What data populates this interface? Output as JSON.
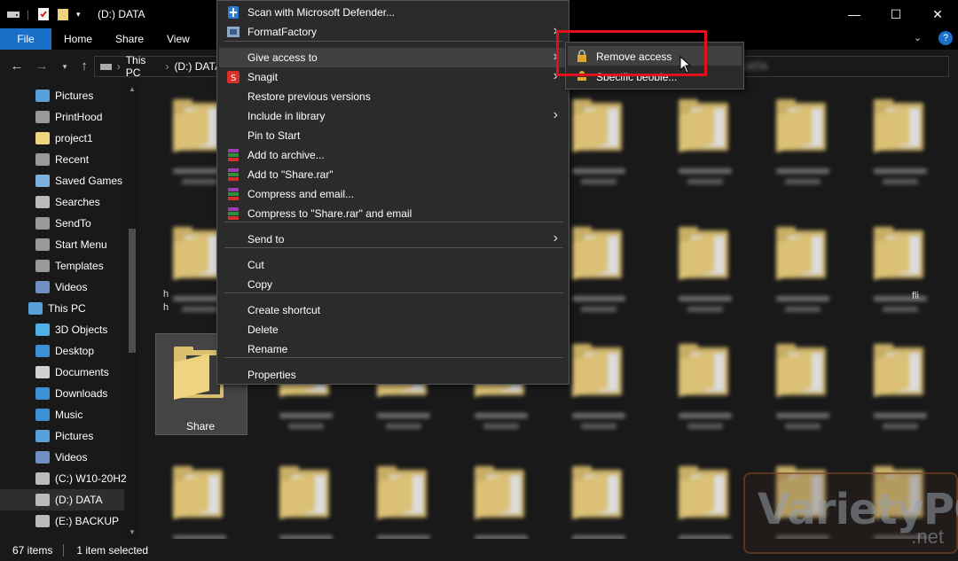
{
  "window": {
    "title": "(D:) DATA",
    "minimize": "—",
    "maximize": "☐",
    "close": "✕",
    "help": "?"
  },
  "ribbon": {
    "tabs": [
      "File",
      "Home",
      "Share",
      "View"
    ]
  },
  "address": {
    "segments": [
      "This PC",
      "(D:) DATA"
    ],
    "search_partial": "DATA"
  },
  "nav": {
    "items": [
      {
        "label": "Pictures",
        "icon": "pictures-icon"
      },
      {
        "label": "PrintHood",
        "icon": "shortcut-folder-icon"
      },
      {
        "label": "project1",
        "icon": "folder-icon"
      },
      {
        "label": "Recent",
        "icon": "recent-icon"
      },
      {
        "label": "Saved Games",
        "icon": "saved-games-icon"
      },
      {
        "label": "Searches",
        "icon": "search-icon"
      },
      {
        "label": "SendTo",
        "icon": "shortcut-folder-icon"
      },
      {
        "label": "Start Menu",
        "icon": "shortcut-folder-icon"
      },
      {
        "label": "Templates",
        "icon": "shortcut-folder-icon"
      },
      {
        "label": "Videos",
        "icon": "videos-icon"
      },
      {
        "label": "This PC",
        "icon": "pc-icon"
      },
      {
        "label": "3D Objects",
        "icon": "3d-objects-icon"
      },
      {
        "label": "Desktop",
        "icon": "desktop-icon"
      },
      {
        "label": "Documents",
        "icon": "documents-icon"
      },
      {
        "label": "Downloads",
        "icon": "downloads-icon"
      },
      {
        "label": "Music",
        "icon": "music-icon"
      },
      {
        "label": "Pictures",
        "icon": "pictures-icon"
      },
      {
        "label": "Videos",
        "icon": "videos-icon"
      },
      {
        "label": "(C:) W10-20H2",
        "icon": "drive-icon"
      },
      {
        "label": "(D:) DATA",
        "icon": "drive-icon"
      },
      {
        "label": "(E:) BACKUP",
        "icon": "drive-icon"
      }
    ]
  },
  "content": {
    "selected_label": "Share",
    "visible_labels": [
      "fli",
      "on Article",
      "h",
      "h"
    ]
  },
  "context_menu": {
    "items": [
      {
        "label": "Scan with Microsoft Defender...",
        "icon": "defender-icon"
      },
      {
        "label": "FormatFactory",
        "icon": "formatfactory-icon",
        "submenu": true
      },
      {
        "label": "Give access to",
        "submenu": true,
        "highlighted": true
      },
      {
        "label": "Snagit",
        "icon": "snagit-icon",
        "submenu": true
      },
      {
        "label": "Restore previous versions"
      },
      {
        "label": "Include in library",
        "submenu": true
      },
      {
        "label": "Pin to Start"
      },
      {
        "label": "Add to archive...",
        "icon": "winrar-icon"
      },
      {
        "label": "Add to \"Share.rar\"",
        "icon": "winrar-icon"
      },
      {
        "label": "Compress and email...",
        "icon": "winrar-icon"
      },
      {
        "label": "Compress to \"Share.rar\" and email",
        "icon": "winrar-icon"
      },
      {
        "label": "Send to",
        "submenu": true
      },
      {
        "label": "Cut"
      },
      {
        "label": "Copy"
      },
      {
        "label": "Create shortcut"
      },
      {
        "label": "Delete"
      },
      {
        "label": "Rename"
      },
      {
        "label": "Properties"
      }
    ]
  },
  "submenu": {
    "items": [
      {
        "label": "Remove access",
        "icon": "lock-icon",
        "highlighted": true
      },
      {
        "label": "Specific people...",
        "icon": "people-icon"
      }
    ]
  },
  "status": {
    "count": "67 items",
    "selected": "1 item selected"
  },
  "watermark": {
    "brand": "VarietyPC",
    "suffix": ".net"
  },
  "colors": {
    "accent": "#1a70c8",
    "highlight_box": "#e0111c",
    "folder": "#dcbf6e"
  }
}
